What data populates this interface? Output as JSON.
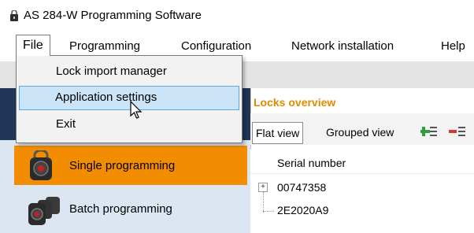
{
  "window": {
    "title": "AS 284-W Programming Software",
    "icon": "padlock-app-icon"
  },
  "menubar": {
    "items": [
      {
        "label": "File"
      },
      {
        "label": "Programming"
      },
      {
        "label": "Configuration"
      },
      {
        "label": "Network installation"
      },
      {
        "label": "Help"
      }
    ]
  },
  "file_menu": {
    "items": [
      {
        "label": "Lock import manager",
        "highlighted": false
      },
      {
        "label": "Application settings",
        "highlighted": true
      },
      {
        "label": "Exit",
        "highlighted": false
      }
    ]
  },
  "sidebar": {
    "items": [
      {
        "label": "Single programming",
        "active": true,
        "icon": "single-lock-icon"
      },
      {
        "label": "Batch programming",
        "active": false,
        "icon": "batch-locks-icon"
      }
    ]
  },
  "main": {
    "section_title": "Locks overview",
    "views": {
      "flat": "Flat view",
      "grouped": "Grouped view"
    },
    "toolbar_icons": [
      "expand-all-icon",
      "collapse-all-icon"
    ],
    "table": {
      "columns": [
        "Serial number"
      ],
      "rows": [
        {
          "serial": "00747358",
          "expandable": true
        },
        {
          "serial": "2E2020A9",
          "expandable": false
        }
      ]
    }
  },
  "colors": {
    "accent_orange": "#f28c00",
    "section_title": "#e08a00",
    "sidebar_dark": "#1f3656",
    "sidebar_light": "#dce6f2",
    "menu_highlight": "#cce4f7"
  }
}
